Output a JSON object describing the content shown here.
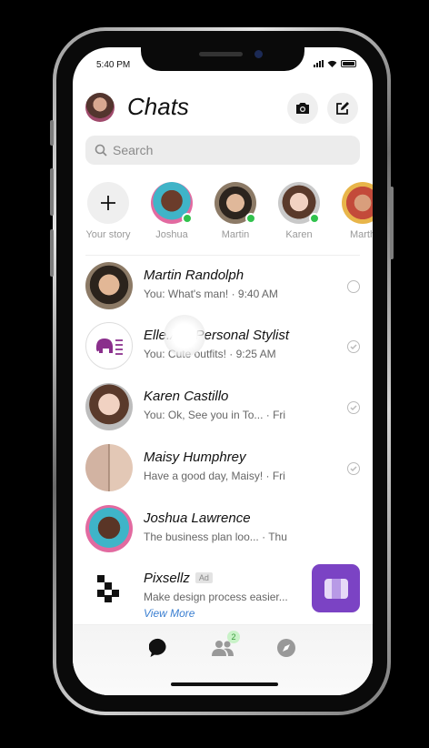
{
  "status_bar": {
    "time": "5:40 PM"
  },
  "header": {
    "title": "Chats"
  },
  "search": {
    "placeholder": "Search"
  },
  "stories": [
    {
      "label": "Your story"
    },
    {
      "label": "Joshua"
    },
    {
      "label": "Martin"
    },
    {
      "label": "Karen"
    },
    {
      "label": "Marth"
    }
  ],
  "chats": [
    {
      "name": "Martin Randolph",
      "message": "You: What's man! · 9:40 AM",
      "status": "sent"
    },
    {
      "name": "Elle.AI - Personal Stylist",
      "message": "You: Cute outfits! · 9:25 AM",
      "status": "delivered"
    },
    {
      "name": "Karen Castillo",
      "message": "You: Ok, See you in To... · Fri",
      "status": "delivered"
    },
    {
      "name": "Maisy Humphrey",
      "message": "Have a good day, Maisy! · Fri",
      "status": "delivered"
    },
    {
      "name": "Joshua Lawrence",
      "message": "The business plan loo...  · Thu",
      "status": "none"
    }
  ],
  "ad": {
    "name": "Pixsellz",
    "badge": "Ad",
    "message": "Make design process easier...",
    "link": "View More"
  },
  "tabbar": {
    "people_badge": "2"
  },
  "colors": {
    "online": "#31c24d",
    "ad_cta": "#7b43c4",
    "link": "#3b7fd1"
  },
  "icons": [
    "camera-icon",
    "compose-icon",
    "search-icon",
    "plus-icon",
    "chat-bubble-icon",
    "people-icon",
    "compass-icon"
  ]
}
